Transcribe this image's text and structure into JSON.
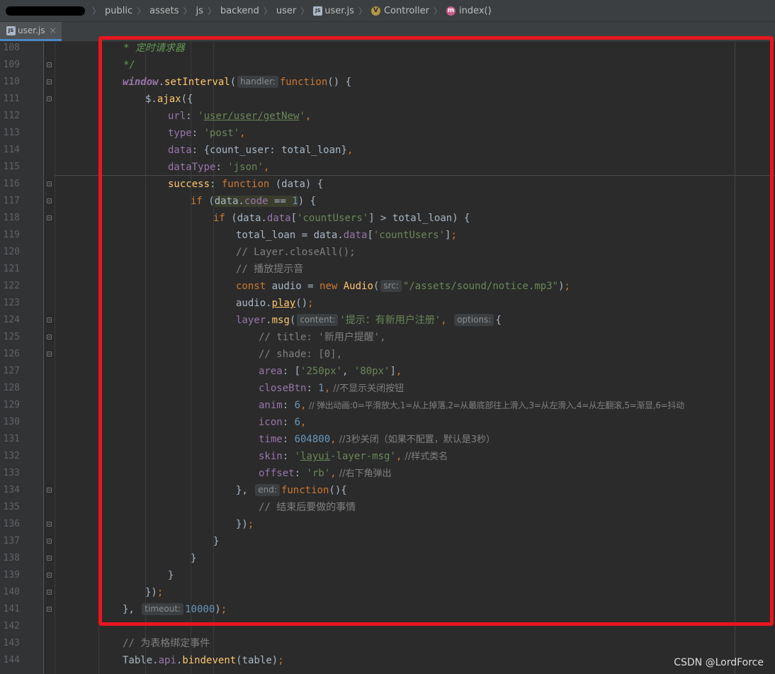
{
  "breadcrumb": {
    "items": [
      "public",
      "assets",
      "js",
      "backend",
      "user",
      "user.js",
      "Controller",
      "index()"
    ],
    "file_badge": "JS",
    "class_badge": "V",
    "method_badge": "m"
  },
  "tab": {
    "label": "user.js",
    "close": "×"
  },
  "line_numbers": [
    "108",
    "109",
    "110",
    "111",
    "112",
    "113",
    "114",
    "115",
    "116",
    "117",
    "118",
    "119",
    "120",
    "121",
    "122",
    "123",
    "124",
    "125",
    "126",
    "127",
    "128",
    "129",
    "130",
    "131",
    "132",
    "133",
    "134",
    "135",
    "136",
    "137",
    "138",
    "139",
    "140",
    "141",
    "142",
    "143",
    "144"
  ],
  "code": {
    "l108": "* 定时请求器",
    "l109": "*/",
    "l110": {
      "obj": "window",
      "dot": ".",
      "call": "setInterval",
      "open": "(",
      "hint": "handler:",
      "kw": "function",
      "rest": "() {"
    },
    "l111": {
      "pre": "$.",
      "call": "ajax",
      "rest": "({"
    },
    "l112": {
      "key": "url",
      "colon": ": ",
      "q1": "'",
      "val": "user/user/getNew",
      "q2": "'",
      "comma": ","
    },
    "l113": {
      "key": "type",
      "colon": ": ",
      "val": "'post'",
      "comma": ","
    },
    "l114": {
      "key": "data",
      "colon": ": {",
      "inner": "count_user: total_loan",
      "close": "}",
      "comma": ","
    },
    "l115": {
      "key": "dataType",
      "colon": ": ",
      "val": "'json'",
      "comma": ","
    },
    "l116": {
      "key": "success",
      "colon": ": ",
      "kw": "function",
      "rest": " (data) {"
    },
    "l117": {
      "kw": "if",
      "open": " (",
      "expr_a": "data.",
      "expr_b": "code",
      "expr_c": " == ",
      "num": "1",
      "rest": ") {"
    },
    "l118": {
      "kw": "if",
      "open": " (data.",
      "prop": "data",
      "b1": "[",
      "str": "'countUsers'",
      "rest": "] > total_loan) {"
    },
    "l119": {
      "pre": "total_loan = data.",
      "prop": "data",
      "b1": "[",
      "str": "'countUsers'",
      "rest": "]",
      "semi": ";"
    },
    "l120": "// Layer.closeAll();",
    "l121": "// 播放提示音",
    "l122": {
      "kw1": "const",
      "mid": " audio = ",
      "kw2": "new",
      "space": " ",
      "cls": "Audio",
      "open": "(",
      "hint": "src:",
      "str": "\"/assets/sound/notice.mp3\"",
      "rest": ")",
      "semi": ";"
    },
    "l123": {
      "pre": "audio.",
      "call": "play",
      "rest": "()",
      "semi": ";"
    },
    "l124": {
      "obj": "layer",
      "dot": ".",
      "call": "msg",
      "open": "(",
      "hint1": "content:",
      "str": "'提示：有新用户注册'",
      "comma": ",",
      "hint2": "options:",
      "rest": "{"
    },
    "l125": "// title: '新用户提醒',",
    "l126": "// shade: [0],",
    "l127": {
      "key": "area",
      "colon": ": [",
      "s1": "'250px'",
      "c1": ", ",
      "s2": "'80px'",
      "rest": "]",
      "comma": ","
    },
    "l128": {
      "key": "closeBtn",
      "colon": ": ",
      "num": "1",
      "comma": ",",
      "cmt": " //不显示关闭按钮"
    },
    "l129": {
      "key": "anim",
      "colon": ": ",
      "num": "6",
      "comma": ",",
      "cmt": " // 弹出动画:0=平滑放大,1=从上掉落,2=从最底部往上滑入,3=从左滑入,4=从左翻滚,5=渐显,6=抖动"
    },
    "l130": {
      "key": "icon",
      "colon": ": ",
      "num": "6",
      "comma": ","
    },
    "l131": {
      "key": "time",
      "colon": ": ",
      "num": "604800",
      "comma": ",",
      "cmt": " //3秒关闭（如果不配置，默认是3秒）"
    },
    "l132": {
      "key": "skin",
      "colon": ": ",
      "q1": "'",
      "str_u": "layui",
      "str_r": "-layer-msg'",
      "comma": ",",
      "cmt": " //样式类名"
    },
    "l133": {
      "key": "offset",
      "colon": ": ",
      "str": "'rb'",
      "comma": ",",
      "cmt": " //右下角弹出"
    },
    "l134": {
      "pre": "},",
      "hint": "end:",
      "kw": "function",
      "rest": "(){"
    },
    "l135": "// 结束后要做的事情",
    "l136": {
      "pre": "})",
      "semi": ";"
    },
    "l137": "}",
    "l138": "}",
    "l139": "}",
    "l140": {
      "pre": "})",
      "semi": ";"
    },
    "l141": {
      "pre": "},",
      "hint": "timeout:",
      "num": "10000",
      "rest": ")",
      "semi": ";"
    },
    "l143": "// 为表格绑定事件",
    "l144": {
      "pre": "Table.",
      "prop": "api",
      "dot": ".",
      "call": "bindevent",
      "rest": "(table)",
      "semi": ";"
    }
  },
  "watermark": "CSDN @LordForce",
  "colors": {
    "highlight_box": "#e8161f",
    "background": "#2b2b2b",
    "keyword": "#cc7832",
    "string": "#6a8759",
    "number": "#6897bb"
  }
}
